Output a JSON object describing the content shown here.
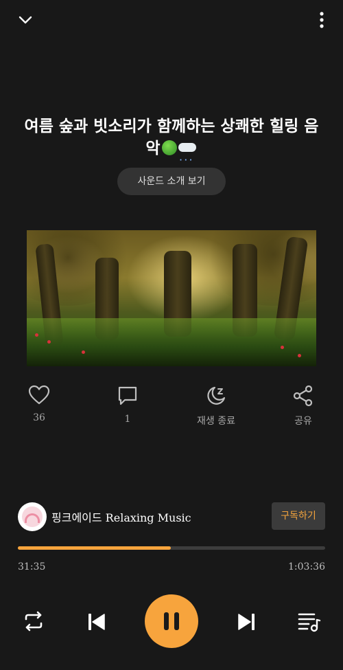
{
  "track": {
    "title": "여름 숲과 빗소리가 함께하는 상쾌한 힐링 음악",
    "emojis": [
      "tree-emoji",
      "cloud-with-snow-emoji"
    ],
    "intro_button_label": "사운드 소개 보기"
  },
  "actions": {
    "like_count": "36",
    "comment_count": "1",
    "sleep_timer_label": "재생 종료",
    "share_label": "공유"
  },
  "channel": {
    "name": "핑크에이드 Relaxing Music",
    "subscribe_label": "구독하기"
  },
  "playback": {
    "current_time": "31:35",
    "total_time": "1:03:36",
    "progress_fraction": 0.497
  },
  "colors": {
    "accent": "#f7a43d",
    "background": "#181818"
  }
}
